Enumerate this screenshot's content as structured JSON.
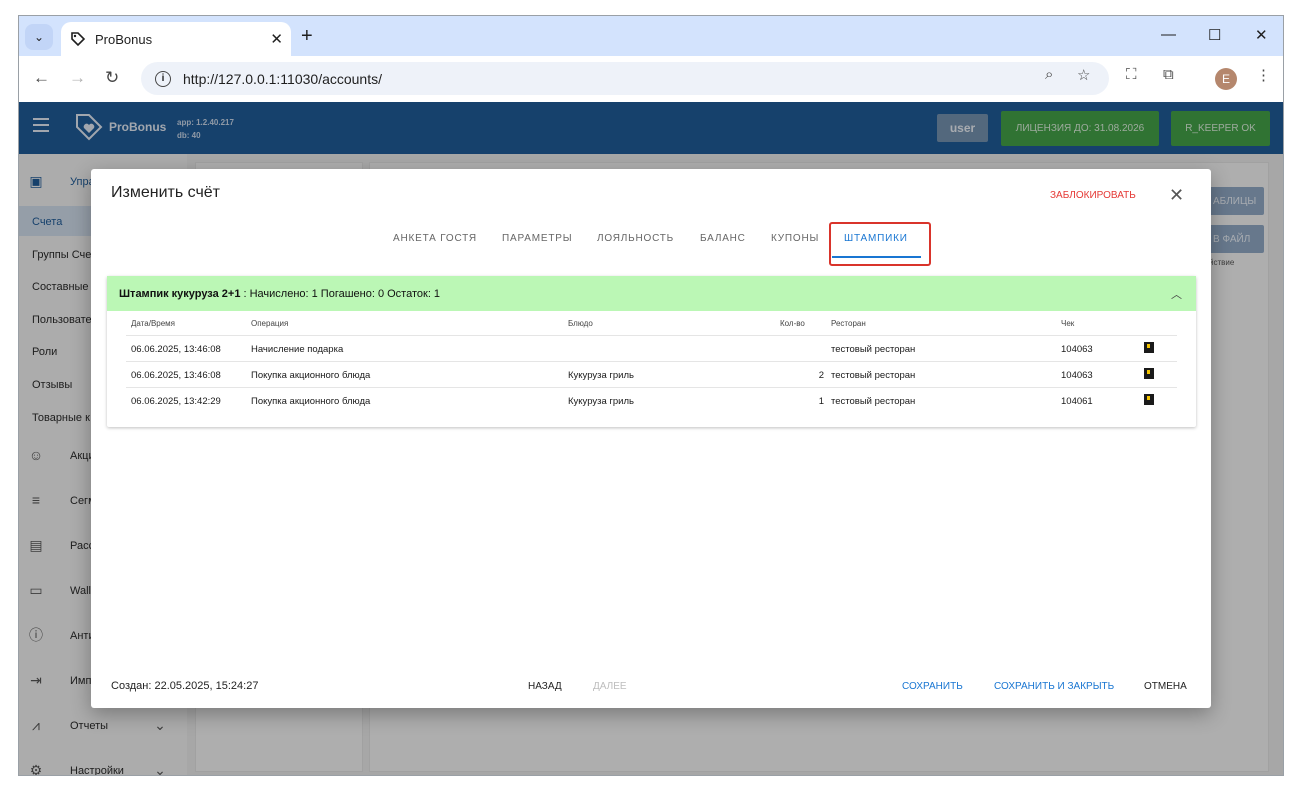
{
  "browser": {
    "tab_title": "ProBonus",
    "url": "http://127.0.0.1:11030/accounts/",
    "profile_initial": "E"
  },
  "app": {
    "logo_text": "ProBonus",
    "version_app": "app: 1.2.40.217",
    "version_db": "db: 40",
    "user_label": "user",
    "license_label": "ЛИЦЕНЗИЯ ДО: 31.08.2026",
    "rkeeper_label": "R_KEEPER OK"
  },
  "sidebar": {
    "group_top": "Упра",
    "items": [
      "Счета",
      "Группы Сче",
      "Составные",
      "Пользовате",
      "Роли",
      "Отзывы",
      "Товарные к"
    ],
    "groups": [
      "Акци",
      "Сегм",
      "Расс",
      "Wall",
      "Анти",
      "Имп",
      "Отчеты",
      "Настройки"
    ]
  },
  "background": {
    "btn_tables": "АБЛИЦЫ",
    "btn_file": "В ФАЙЛ",
    "col_action": "йствие"
  },
  "dialog": {
    "title": "Изменить счёт",
    "block_label": "ЗАБЛОКИРОВАТЬ",
    "tabs": [
      "АНКЕТА ГОСТЯ",
      "ПАРАМЕТРЫ",
      "ЛОЯЛЬНОСТЬ",
      "БАЛАНС",
      "КУПОНЫ",
      "ШТАМПИКИ"
    ],
    "active_tab": "ШТАМПИКИ",
    "stamp": {
      "name": "Штампик кукуруза 2+1",
      "summary": ": Начислено: 1 Погашено: 0 Остаток: 1"
    },
    "columns": [
      "Дата/Время",
      "Операция",
      "Блюдо",
      "Кол-во",
      "Ресторан",
      "Чек"
    ],
    "rows": [
      {
        "datetime": "06.06.2025, 13:46:08",
        "operation": "Начисление подарка",
        "dish": "",
        "qty": "",
        "restaurant": "тестовый ресторан",
        "check": "104063"
      },
      {
        "datetime": "06.06.2025, 13:46:08",
        "operation": "Покупка акционного блюда",
        "dish": "Кукуруза гриль",
        "qty": "2",
        "restaurant": "тестовый ресторан",
        "check": "104063"
      },
      {
        "datetime": "06.06.2025, 13:42:29",
        "operation": "Покупка акционного блюда",
        "dish": "Кукуруза гриль",
        "qty": "1",
        "restaurant": "тестовый ресторан",
        "check": "104061"
      }
    ],
    "created": "Создан: 22.05.2025, 15:24:27",
    "back_label": "НАЗАД",
    "next_label": "ДАЛЕЕ",
    "save_label": "СОХРАНИТЬ",
    "save_close_label": "СОХРАНИТЬ И ЗАКРЫТЬ",
    "cancel_label": "ОТМЕНА"
  },
  "colors": {
    "appbar": "#1f5a96",
    "accent": "#1976d2",
    "danger": "#e53935",
    "stamp_header": "#bbf7b5",
    "license_green": "#43a047"
  }
}
